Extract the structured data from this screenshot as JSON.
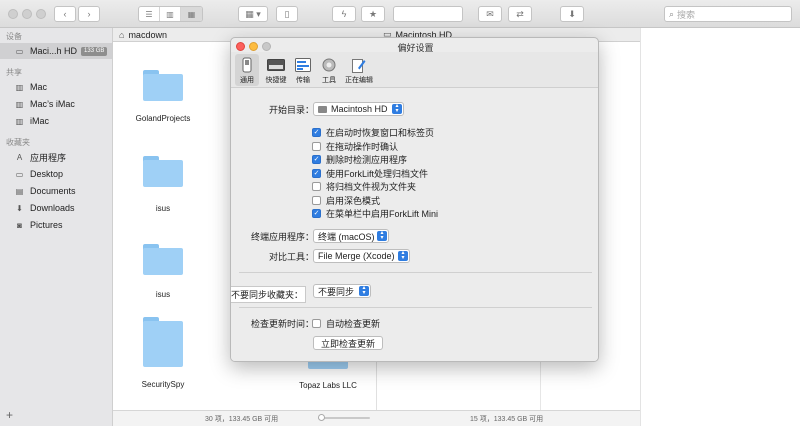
{
  "toolbar": {
    "back_icon": "chevron-left",
    "forward_icon": "chevron-right",
    "search_placeholder": "搜索"
  },
  "sidebar": {
    "sections": [
      {
        "title": "设备",
        "items": [
          {
            "label": "Maci...h HD",
            "badge": "133 GB",
            "icon": "disk",
            "selected": true
          }
        ]
      },
      {
        "title": "共享",
        "items": [
          {
            "label": "Mac",
            "icon": "computer"
          },
          {
            "label": "Mac’s iMac",
            "icon": "computer"
          },
          {
            "label": "iMac",
            "icon": "computer"
          }
        ]
      },
      {
        "title": "收藏夹",
        "items": [
          {
            "label": "应用程序",
            "icon": "applications"
          },
          {
            "label": "Desktop",
            "icon": "desktop"
          },
          {
            "label": "Documents",
            "icon": "documents"
          },
          {
            "label": "Downloads",
            "icon": "downloads"
          },
          {
            "label": "Pictures",
            "icon": "pictures"
          }
        ]
      }
    ],
    "add_label": "+"
  },
  "left_pane": {
    "path": "macdown",
    "folders": [
      "GolandProjects",
      "isus",
      "isus",
      "SecuritySpy",
      "Topaz Labs LLC"
    ],
    "status": "30 项，133.45 GB 可用"
  },
  "right_pane": {
    "path": "Macintosh HD",
    "status": "15 项，133.45 GB 可用"
  },
  "dialog": {
    "title": "偏好设置",
    "tabs": [
      "通用",
      "快捷键",
      "传输",
      "工具",
      "正在编辑"
    ],
    "start_dir_label": "开始目录：",
    "start_dir_value": "Macintosh HD",
    "options": [
      {
        "label": "在启动时恢复窗口和标签页",
        "checked": true
      },
      {
        "label": "在拖动操作时确认",
        "checked": false
      },
      {
        "label": "删除时检测应用程序",
        "checked": true
      },
      {
        "label": "使用ForkLift处理归档文件",
        "checked": true
      },
      {
        "label": "将归档文件视为文件夹",
        "checked": false
      },
      {
        "label": "启用深色模式",
        "checked": false
      },
      {
        "label": "在菜单栏中启用ForkLift Mini",
        "checked": true
      }
    ],
    "terminal_label": "终端应用程序：",
    "terminal_value": "终端 (macOS)",
    "compare_label": "对比工具：",
    "compare_value": "File Merge (Xcode)",
    "sync_label": "不要同步收藏夹：",
    "sync_value": "不要同步",
    "update_label": "检查更新时间：",
    "auto_update_label": "自动检查更新",
    "auto_update_checked": false,
    "check_now_button": "立即检查更新"
  }
}
